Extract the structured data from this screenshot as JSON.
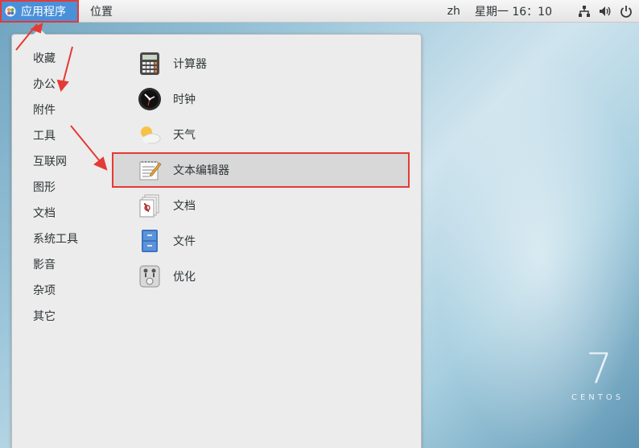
{
  "top_panel": {
    "applications_label": "应用程序",
    "places_label": "位置",
    "language": "zh",
    "clock": "星期一 16：10",
    "icons": [
      "network-icon",
      "volume-icon",
      "power-icon"
    ]
  },
  "menu": {
    "categories": [
      {
        "label": "收藏"
      },
      {
        "label": "办公"
      },
      {
        "label": "附件"
      },
      {
        "label": "工具"
      },
      {
        "label": "互联网"
      },
      {
        "label": "图形"
      },
      {
        "label": "文档"
      },
      {
        "label": "系统工具"
      },
      {
        "label": "影音"
      },
      {
        "label": "杂项"
      },
      {
        "label": "其它"
      }
    ],
    "selected_category": "附件",
    "apps": [
      {
        "label": "计算器",
        "icon": "calculator-icon"
      },
      {
        "label": "时钟",
        "icon": "clock-icon"
      },
      {
        "label": "天气",
        "icon": "weather-icon"
      },
      {
        "label": "文本编辑器",
        "icon": "text-editor-icon"
      },
      {
        "label": "文档",
        "icon": "documents-icon"
      },
      {
        "label": "文件",
        "icon": "files-icon"
      },
      {
        "label": "优化",
        "icon": "tweaks-icon"
      }
    ],
    "selected_app": "文本编辑器"
  },
  "desktop": {
    "brand_number": "7",
    "brand_word": "CENTOS"
  },
  "colors": {
    "accent": "#4a90d9",
    "annotation": "#e53935"
  }
}
